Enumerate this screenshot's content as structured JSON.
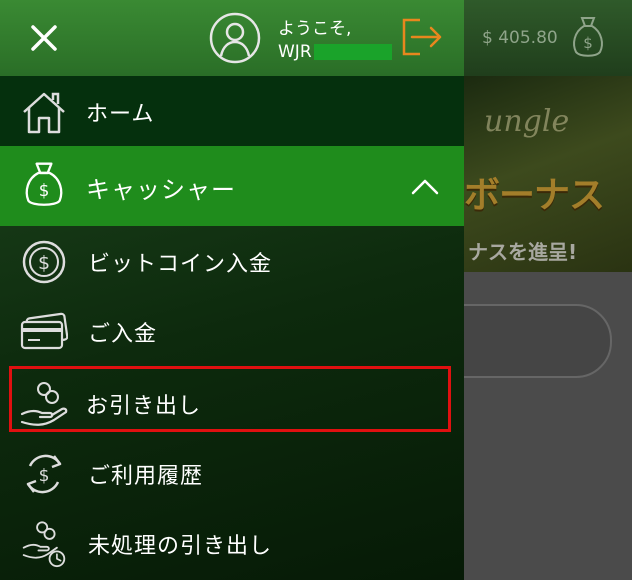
{
  "background": {
    "balance": "$ 405.80",
    "banner": {
      "jungle_text": "ungle",
      "bonus_text": "ボーナス",
      "promo_text": "ナスを進呈!"
    }
  },
  "menu": {
    "header": {
      "welcome": "ようこそ,",
      "username": "WJR"
    },
    "home": "ホーム",
    "cashier": "キャッシャー",
    "cashier_items": {
      "bitcoin": "ビットコイン入金",
      "deposit": "ご入金",
      "withdraw": "お引き出し",
      "history": "ご利用履歴",
      "pending": "未処理の引き出し"
    }
  },
  "colors": {
    "header_green": "#2a6e27",
    "active_green": "#1f8c1c",
    "logout_orange": "#e8871e",
    "highlight_red": "#e01010"
  },
  "icons": [
    "close-icon",
    "user-avatar-icon",
    "logout-icon",
    "money-bag-icon",
    "home-icon",
    "chevron-up-icon",
    "dollar-coin-icon",
    "credit-card-icon",
    "coins-hand-icon",
    "refresh-dollar-icon",
    "coins-hand-clock-icon"
  ]
}
